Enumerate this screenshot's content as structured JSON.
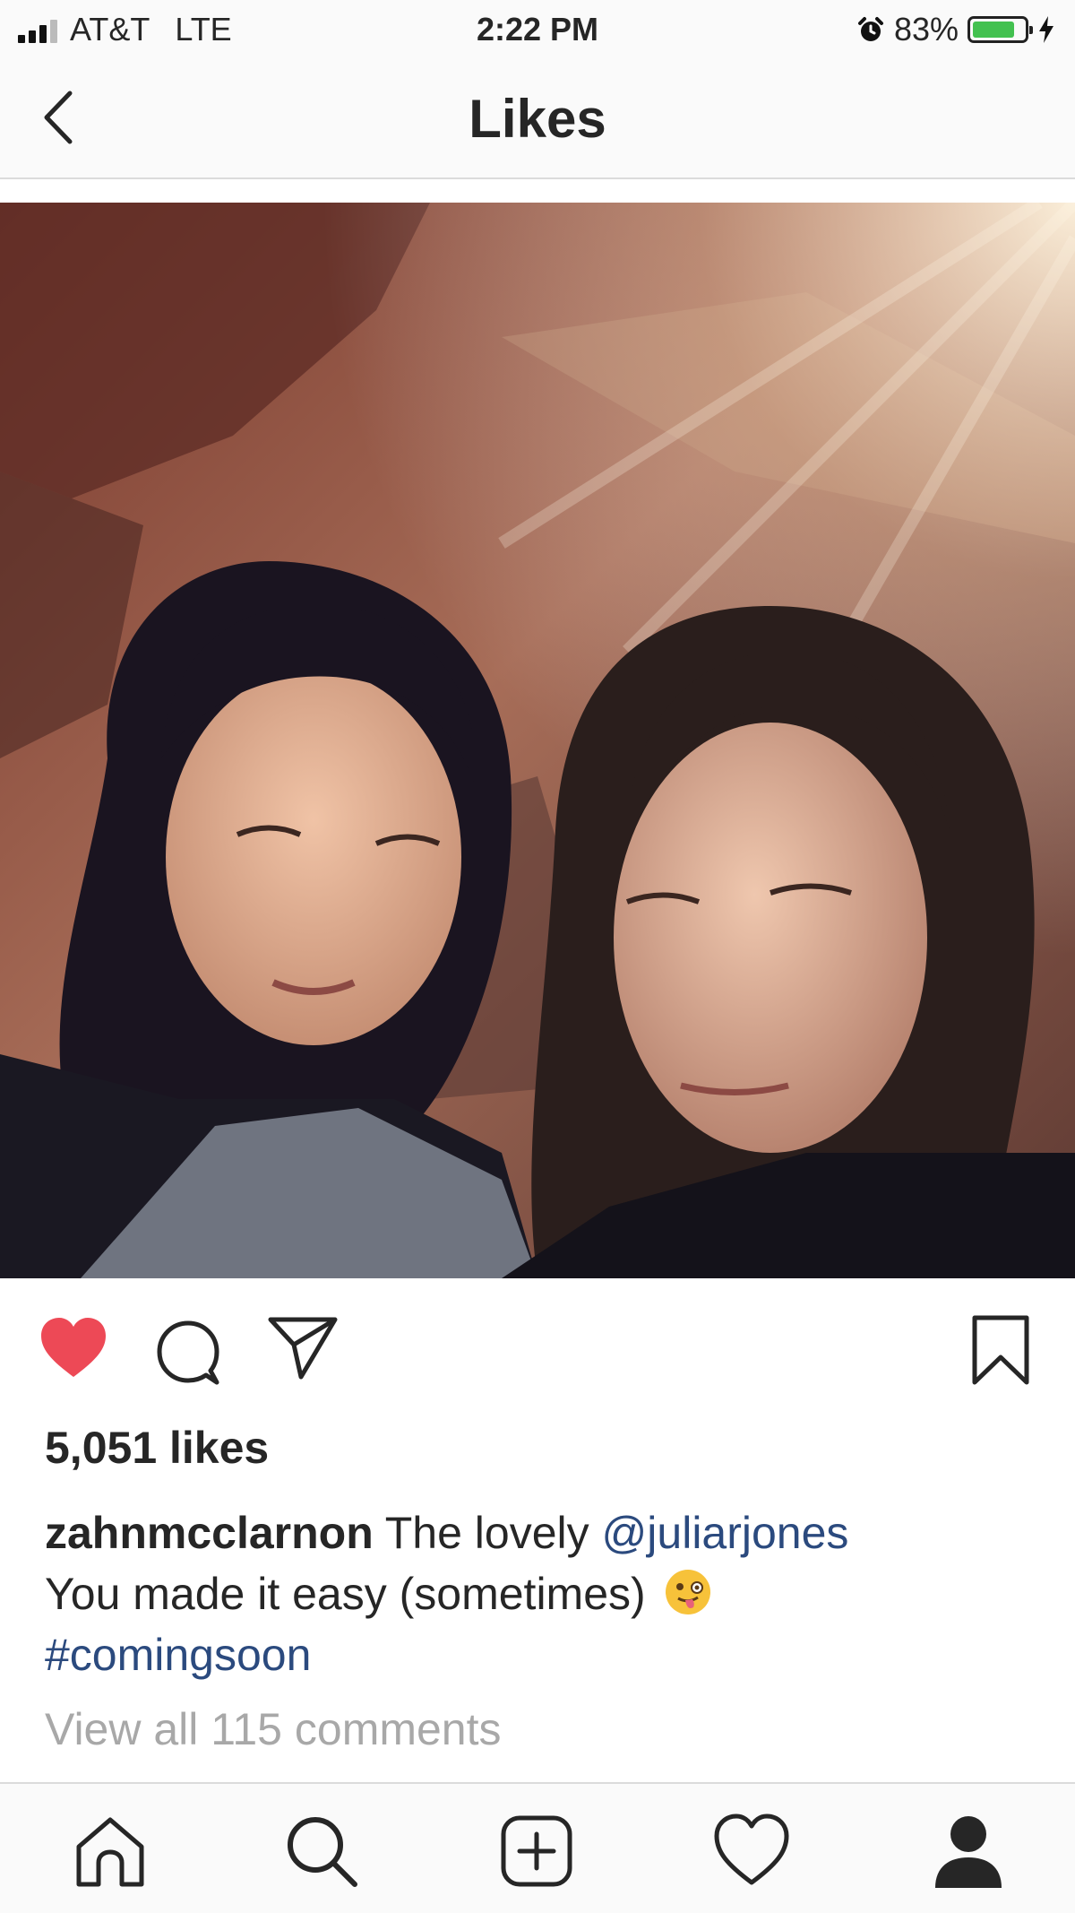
{
  "status_bar": {
    "carrier": "AT&T",
    "network": "LTE",
    "time": "2:22 PM",
    "battery_percent_label": "83%",
    "battery_level": 0.83,
    "icons": [
      "signal-icon",
      "alarm-icon",
      "battery-icon",
      "charging-icon"
    ]
  },
  "nav": {
    "title": "Likes",
    "back_icon": "chevron-left-icon"
  },
  "post": {
    "photo_icon": "photo",
    "actions": {
      "liked": true,
      "like_color": "#ed4956",
      "icons": [
        "heart-icon",
        "comment-icon",
        "share-icon",
        "bookmark-icon"
      ]
    },
    "likes_text": "5,051 likes",
    "caption": {
      "username": "zahnmcclarnon",
      "text_before_mention": "The lovely",
      "mention": "@juliarjones",
      "line2": "You made it easy (sometimes)",
      "emoji": "winking-face-with-tongue",
      "hashtag": "#comingsoon"
    },
    "view_comments": "View all 115 comments",
    "link_color": "#2b4a7e"
  },
  "tab_bar": {
    "items": [
      "home-icon",
      "search-icon",
      "add-icon",
      "activity-heart-icon",
      "profile-icon"
    ]
  }
}
